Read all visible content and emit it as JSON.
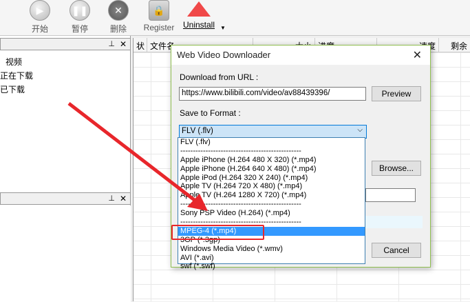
{
  "toolbar": {
    "items": [
      {
        "label": "开始",
        "icon": "play-icon"
      },
      {
        "label": "暂停",
        "icon": "pause-icon"
      },
      {
        "label": "删除",
        "icon": "delete-icon"
      },
      {
        "label": "Register",
        "icon": "lock-icon"
      },
      {
        "label": "Uninstall",
        "icon": "uninstall-arrow-icon"
      }
    ]
  },
  "left_panel": {
    "items": [
      "视频",
      "正在下载",
      "已下载"
    ],
    "pin": "ᵖ",
    "close": "✕"
  },
  "list": {
    "columns": [
      "状",
      "文件名",
      "大小",
      "进度",
      "速度",
      "剩余"
    ]
  },
  "dialog": {
    "title": "Web Video Downloader",
    "url_label": "Download from URL :",
    "url_value": "https://www.bilibili.com/video/av88439396/",
    "preview": "Preview",
    "format_label": "Save to Format :",
    "format_selected": "FLV (.flv)",
    "browse": "Browse...",
    "cancel": "Cancel",
    "options": [
      "FLV (.flv)",
      "------------------------------------------------",
      "Apple iPhone   (H.264 480 X 320) (*.mp4)",
      "Apple iPhone    (H.264 640 X 480) (*.mp4)",
      "Apple iPod    (H.264 320 X 240) (*.mp4)",
      "Apple TV    (H.264 720 X 480) (*.mp4)",
      "Apple TV    (H.264 1280 X 720) (*.mp4)",
      "------------------------------------------------",
      "Sony PSP Video   (H.264) (*.mp4)",
      "------------------------------------------------",
      "MPEG-4 (*.mp4)",
      "3GP (*.3gp)",
      "Windows Media Video (*.wmv)",
      "AVI (*.avi)",
      "swf (*.swf)"
    ],
    "highlighted_index": 10
  },
  "colors": {
    "accent": "#3399ff",
    "annotation": "#e8262b"
  }
}
